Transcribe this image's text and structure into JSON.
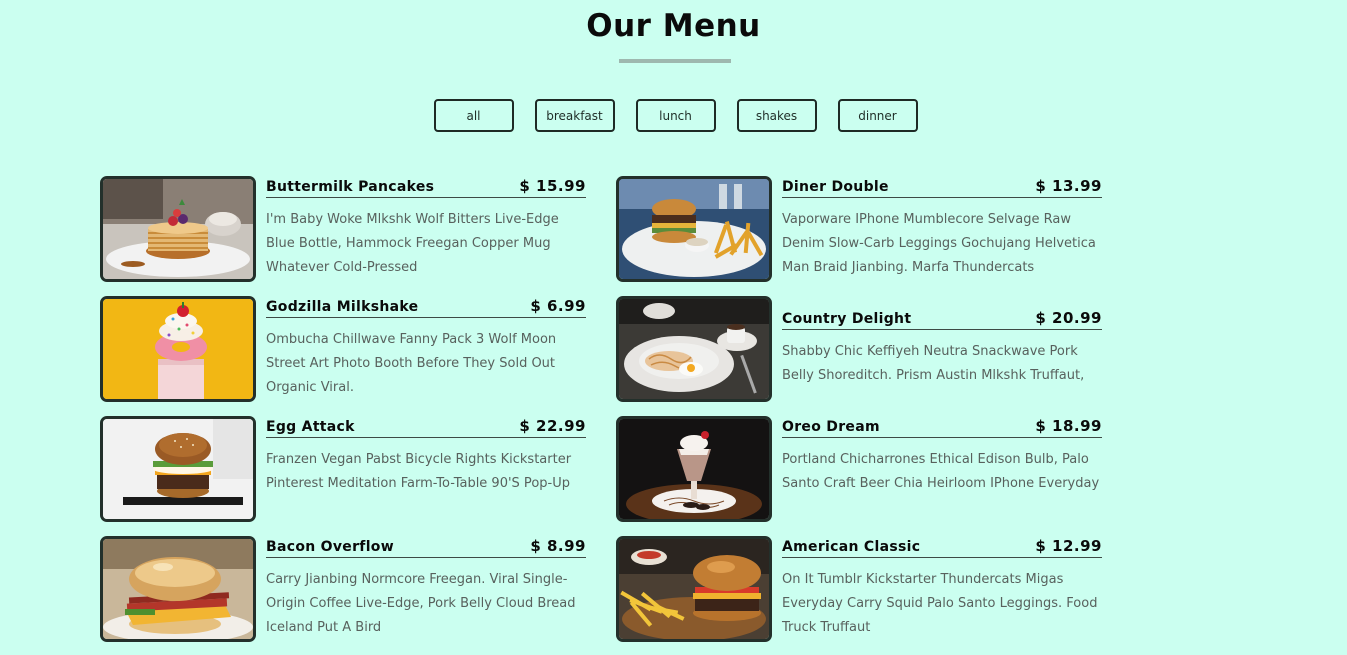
{
  "header": {
    "title": "Our Menu"
  },
  "filters": [
    "all",
    "breakfast",
    "lunch",
    "shakes",
    "dinner"
  ],
  "menu": [
    {
      "name": "Buttermilk Pancakes",
      "price": "$ 15.99",
      "description": "I'm Baby Woke Mlkshk Wolf Bitters Live-Edge Blue Bottle, Hammock Freegan Copper Mug Whatever Cold-Pressed",
      "image": "pancakes-image"
    },
    {
      "name": "Diner Double",
      "price": "$ 13.99",
      "description": "Vaporware IPhone Mumblecore Selvage Raw Denim Slow-Carb Leggings Gochujang Helvetica Man Braid Jianbing. Marfa Thundercats",
      "image": "burger-fries-image"
    },
    {
      "name": "Godzilla Milkshake",
      "price": "$ 6.99",
      "description": "Ombucha Chillwave Fanny Pack 3 Wolf Moon Street Art Photo Booth Before They Sold Out Organic Viral.",
      "image": "milkshake-image"
    },
    {
      "name": "Country Delight",
      "price": "$ 20.99",
      "description": "Shabby Chic Keffiyeh Neutra Snackwave Pork Belly Shoreditch. Prism Austin Mlkshk Truffaut,",
      "image": "breakfast-plate-image"
    },
    {
      "name": "Egg Attack",
      "price": "$ 22.99",
      "description": "Franzen Vegan Pabst Bicycle Rights Kickstarter Pinterest Meditation Farm-To-Table 90'S Pop-Up",
      "image": "egg-burger-image"
    },
    {
      "name": "Oreo Dream",
      "price": "$ 18.99",
      "description": "Portland Chicharrones Ethical Edison Bulb, Palo Santo Craft Beer Chia Heirloom IPhone Everyday",
      "image": "oreo-shake-image"
    },
    {
      "name": "Bacon Overflow",
      "price": "$ 8.99",
      "description": "Carry Jianbing Normcore Freegan. Viral Single-Origin Coffee Live-Edge, Pork Belly Cloud Bread Iceland Put A Bird",
      "image": "bacon-sandwich-image"
    },
    {
      "name": "American Classic",
      "price": "$ 12.99",
      "description": "On It Tumblr Kickstarter Thundercats Migas Everyday Carry Squid Palo Santo Leggings. Food Truck Truffaut",
      "image": "classic-burger-image"
    }
  ]
}
